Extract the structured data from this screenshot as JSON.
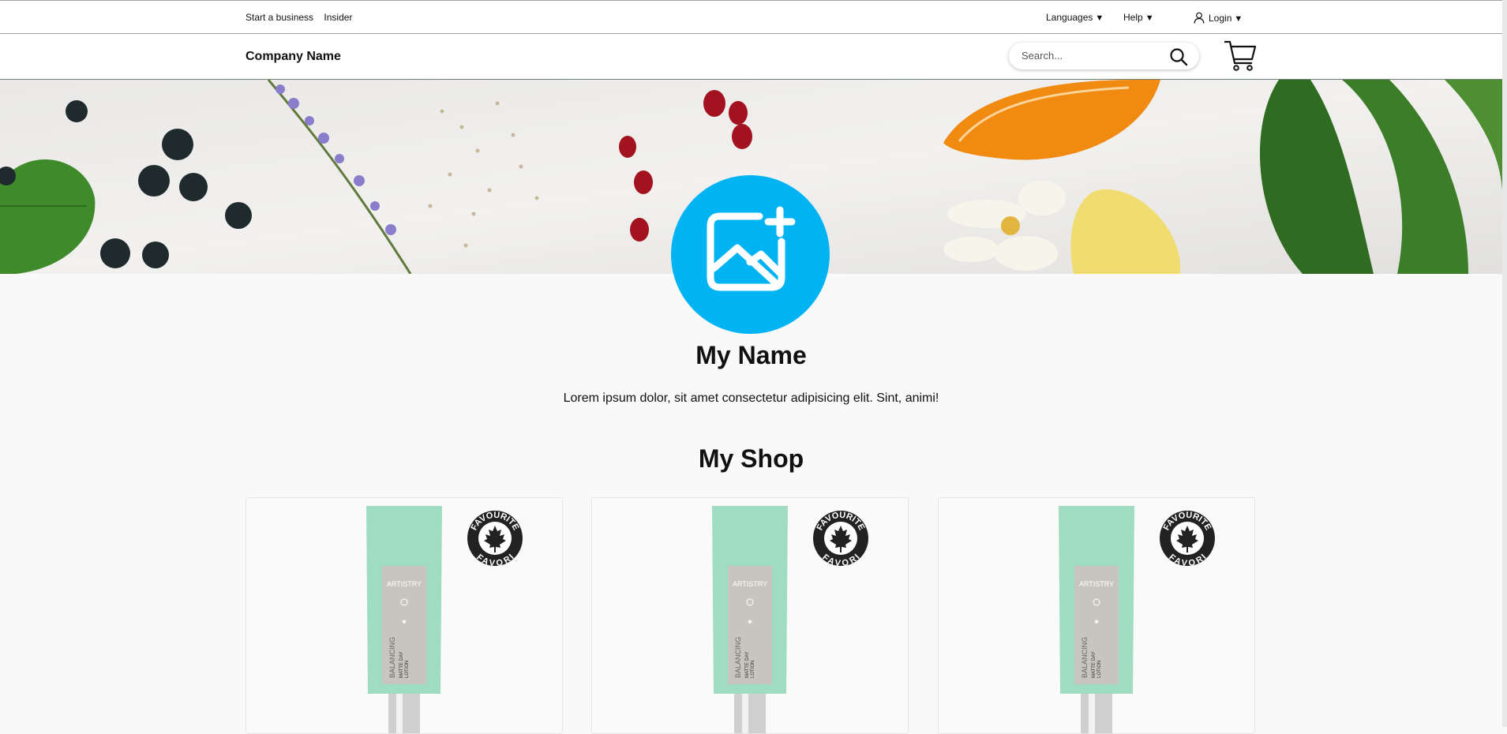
{
  "topbar": {
    "links": [
      "Start a business",
      "Insider"
    ],
    "languages": "Languages",
    "help": "Help",
    "login": "Login",
    "caret": "▼"
  },
  "header": {
    "company": "Company Name",
    "search_placeholder": "Search..."
  },
  "profile": {
    "name": "My Name",
    "bio": "Lorem ipsum dolor, sit amet consectetur adipisicing elit. Sint, animi!"
  },
  "shop": {
    "title": "My Shop",
    "products": [
      {
        "brand": "ARTISTRY",
        "badge_top": "FAVOURITE",
        "badge_bottom": "FAVORI",
        "product_lines": [
          "BALANCING",
          "MATTE DAY",
          "LOTION"
        ]
      },
      {
        "brand": "ARTISTRY",
        "badge_top": "FAVOURITE",
        "badge_bottom": "FAVORI",
        "product_lines": [
          "BALANCING",
          "MATTE DAY",
          "LOTION"
        ]
      },
      {
        "brand": "ARTISTRY",
        "badge_top": "FAVOURITE",
        "badge_bottom": "FAVORI",
        "product_lines": [
          "BALANCING",
          "MATTE DAY",
          "LOTION"
        ]
      }
    ]
  },
  "colors": {
    "accent": "#00b4f4",
    "tube": "#9fdcc2",
    "label": "#c8c5bf",
    "badge": "#222222"
  },
  "icons": [
    "search-icon",
    "cart-icon",
    "user-icon",
    "add-image-icon",
    "maple-leaf-icon"
  ]
}
